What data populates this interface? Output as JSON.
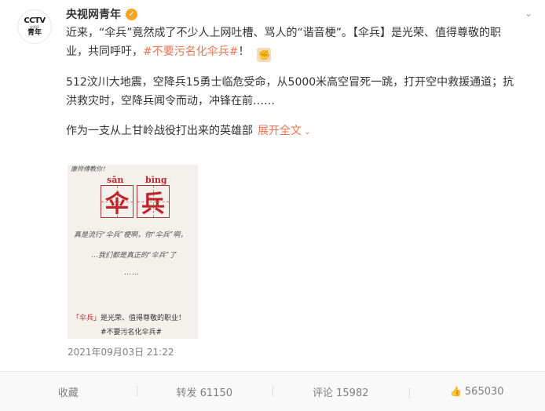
{
  "header": {
    "username": "央视网青年",
    "avatar": {
      "logo_top": "CCTV",
      "logo_mid": "央视网",
      "logo_bottom": "青年"
    },
    "verified_icon": "verified-badge-icon",
    "more_icon": "chevron-down-icon"
  },
  "post": {
    "p1_a": "近来，“伞兵”竟然成了不少人上网吐槽、骂人的“谐音梗”。【伞兵】是光荣、值得尊敬的职业，共同呼吁，",
    "p1_hashtag": "#不要污名化伞兵#",
    "p1_b": "！",
    "fist_icon": "fist-emoji-icon",
    "p2": "512汶川大地震，空降兵15勇士临危受命，从5000米高空冒死一跳，打开空中救援通道；抗洪救灾时，空降兵闻令而动，冲锋在前……",
    "p3": "作为一支从上甘岭战役打出来的英雄部",
    "expand_label": "展开全文"
  },
  "image": {
    "top_label": "康师傅教你！",
    "pinyin_1": "sǎn",
    "pinyin_2": "bīng",
    "char_1": "伞",
    "char_2": "兵",
    "line_1": "真是流行“伞兵”梗啊，你“伞兵”啊，",
    "line_2": "…我们都是真正的“伞兵”了",
    "dots": "……",
    "line_3_red": "「伞兵」",
    "line_3_rest": "是光荣、值得尊敬的职业！",
    "line_4": "#不要污名化伞兵#"
  },
  "timestamp": "2021年09月03日 21:22",
  "footer": {
    "collect_label": "收藏",
    "repost_label": "转发 61150",
    "comment_label": "评论 15982",
    "like_count": "565030",
    "like_icon": "thumbs-up-icon"
  }
}
